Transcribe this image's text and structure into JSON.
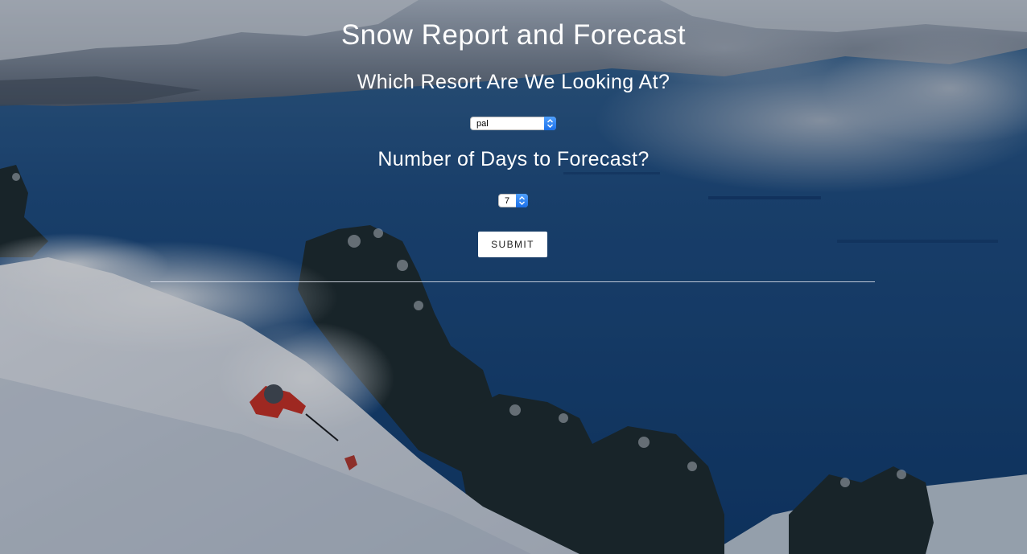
{
  "page": {
    "title": "Snow Report and Forecast"
  },
  "form": {
    "resort_question": "Which Resort Are We Looking At?",
    "resort_selected": "pal",
    "days_question": "Number of Days to Forecast?",
    "days_selected": "7",
    "submit_label": "SUBMIT"
  },
  "colors": {
    "lake": "#17447a",
    "snow": "#e9edf3",
    "jacket": "#d7301f",
    "select_arrow": "#1a6fe8"
  }
}
